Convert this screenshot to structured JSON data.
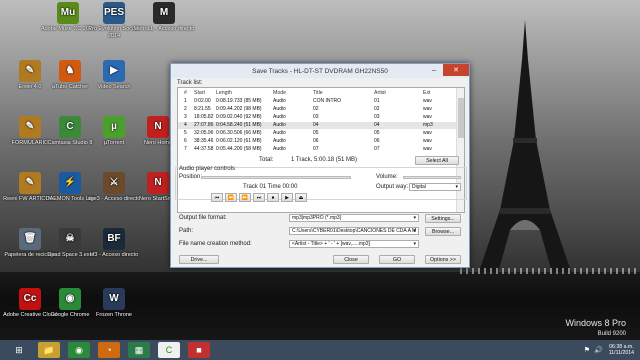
{
  "desktop": {
    "watermark": {
      "line1": "Windows 8 Pro",
      "line2": "Build 9200"
    },
    "icons": [
      {
        "label": "Adobe Muse CC 2014",
        "glyph": "Mu",
        "color": "#5a8a1a"
      },
      {
        "label": "Pro Evolution Soccer 2014",
        "glyph": "PES",
        "color": "#2a5a8a"
      },
      {
        "label": "MetroLL - Acceso directo",
        "glyph": "M",
        "color": "#2a2a2a"
      },
      {
        "label": "Erwin 4.0",
        "glyph": "✎",
        "color": "#b07a20"
      },
      {
        "label": "aTube Catcher",
        "glyph": "♞",
        "color": "#d05a10"
      },
      {
        "label": "Video Search",
        "glyph": "▶",
        "color": "#2a6ab0"
      },
      {
        "label": "FORMULARIO",
        "glyph": "✎",
        "color": "#b07a20"
      },
      {
        "label": "Camtasia Studio 8",
        "glyph": "C",
        "color": "#3a8a3a"
      },
      {
        "label": "µTorrent",
        "glyph": "µ",
        "color": "#4aa02a"
      },
      {
        "label": "Nero Home",
        "glyph": "N",
        "color": "#c02020"
      },
      {
        "label": "Reeni FW ARTICUL...",
        "glyph": "✎",
        "color": "#b07a20"
      },
      {
        "label": "DAEMON Tools Lite",
        "glyph": "⚡",
        "color": "#1a5aa0"
      },
      {
        "label": "age3 - Acceso directo",
        "glyph": "⚔",
        "color": "#6a4a2a"
      },
      {
        "label": "Nero StartSm...",
        "glyph": "N",
        "color": "#c02020"
      },
      {
        "label": "Papelera de reciclaje",
        "glyph": "🗑",
        "color": "#5a6a7a"
      },
      {
        "label": "Dead Space 3.exe",
        "glyph": "☠",
        "color": "#3a3a3a"
      },
      {
        "label": "bf3 - Acceso directo",
        "glyph": "BF",
        "color": "#1a2a3a"
      },
      {
        "label": "Adobe Creative Cloud",
        "glyph": "Cc",
        "color": "#c01010"
      },
      {
        "label": "Google Chrome",
        "glyph": "◉",
        "color": "#2a8a3a"
      },
      {
        "label": "Frozen Throne",
        "glyph": "W",
        "color": "#2a3a5a"
      }
    ]
  },
  "dialog": {
    "title": "Save Tracks - HL-DT-ST DVDRAM GH22NS50",
    "tracklist_label": "Track list:",
    "columns": [
      "#",
      "Start",
      "Length",
      "Mode",
      "Title",
      "Artist",
      "Ext"
    ],
    "rows": [
      [
        "1",
        "0:02.00",
        "0:08.19.733 (85 MB)",
        "Audio",
        "CON INTRO",
        "01",
        "wav"
      ],
      [
        "2",
        "8:21.55",
        "0:09.44.202 (98 MB)",
        "Audio",
        "02",
        "02",
        "wav"
      ],
      [
        "3",
        "18:05.82",
        "0:09.02.040 (92 MB)",
        "Audio",
        "03",
        "03",
        "wav"
      ],
      [
        "4",
        "27:07.86",
        "0:04.58.240 (51 MB)",
        "Audio",
        "04",
        "04",
        "mp3"
      ],
      [
        "5",
        "32:05.96",
        "0:06.30.506 (66 MB)",
        "Audio",
        "05",
        "05",
        "wav"
      ],
      [
        "6",
        "38:35.46",
        "0:06.02.120 (61 MB)",
        "Audio",
        "06",
        "06",
        "wav"
      ],
      [
        "7",
        "44:37.58",
        "0:05.44.200 (58 MB)",
        "Audio",
        "07",
        "07",
        "wav"
      ]
    ],
    "selected_row": 3,
    "total_label": "Total:",
    "total_value": "1 Track,    5:00.18 (51 MB)",
    "select_all": "Select All",
    "player_label": "Audio player controls",
    "position_label": "Position:",
    "volume_label": "Volume:",
    "output_way_label": "Output way:",
    "output_way_value": "Digital",
    "now_playing": "Track 01 Time 00:00",
    "player_buttons": [
      "⏮",
      "⏪",
      "⏩",
      "⏭",
      "⏹",
      "▶",
      "⏏"
    ],
    "output_format_label": "Output file format:",
    "output_format_value": "mp3|mp3PRO (*.mp3)",
    "settings": "Settings...",
    "path_label": "Path:",
    "path_value": "C:\\Users\\CYBER01\\Desktop\\CANCIONES DE CDA A M",
    "browse": "Browse...",
    "naming_label": "File name creation method:",
    "naming_value": "<Artist - Title> + ' - ' + [wav,.....mp3]",
    "drive": "Drive...",
    "close": "Close",
    "go": "GO",
    "options": "Options >>"
  },
  "taskbar": {
    "items": [
      {
        "name": "start-icon",
        "glyph": "⊞",
        "color": "#3b4a5c"
      },
      {
        "name": "explorer-icon",
        "glyph": "📁",
        "color": "#c8a030"
      },
      {
        "name": "chrome-icon",
        "glyph": "◉",
        "color": "#2a8a3a"
      },
      {
        "name": "firefox-icon",
        "glyph": "◔",
        "color": "#d06a10"
      },
      {
        "name": "store-icon",
        "glyph": "▦",
        "color": "#2a7a4a"
      },
      {
        "name": "cdex-icon",
        "glyph": "C",
        "color": "#f0f0f0"
      },
      {
        "name": "media-icon",
        "glyph": "■",
        "color": "#c03030"
      }
    ],
    "time": "06:38 a.m.",
    "date": "11/11/2014"
  }
}
